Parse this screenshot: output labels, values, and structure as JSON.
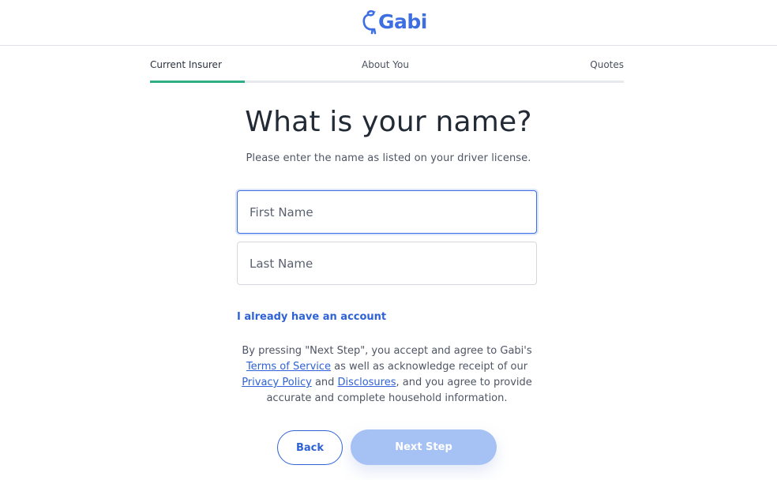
{
  "brand": {
    "name": "Gabi",
    "accent_color": "#3d6fe3",
    "progress_color": "#2fae86"
  },
  "steps": {
    "items": [
      {
        "label": "Current Insurer"
      },
      {
        "label": "About You"
      },
      {
        "label": "Quotes"
      }
    ],
    "current_progress": 0.2
  },
  "form": {
    "title": "What is your name?",
    "subtitle": "Please enter the name as listed on your driver license.",
    "first_name": {
      "placeholder": "First Name",
      "value": ""
    },
    "last_name": {
      "placeholder": "Last Name",
      "value": ""
    },
    "account_link": "I already have an account"
  },
  "legal": {
    "part1": "By pressing \"Next Step\", you accept and agree to Gabi's",
    "terms_link": "Terms of Service",
    "part2": "as well as acknowledge receipt of our",
    "privacy_link": "Privacy Policy",
    "part3": "and",
    "disclosures_link": "Disclosures",
    "part4": ", and you agree to provide accurate and complete household information."
  },
  "buttons": {
    "back": "Back",
    "next": "Next Step"
  }
}
